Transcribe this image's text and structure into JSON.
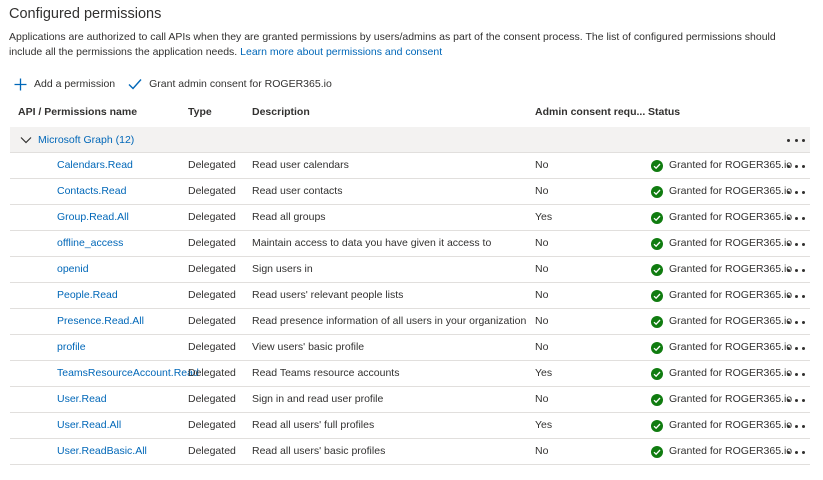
{
  "page": {
    "title": "Configured permissions",
    "description": "Applications are authorized to call APIs when they are granted permissions by users/admins as part of the consent process. The list of configured permissions should include all the permissions the application needs.",
    "learn_more_link": "Learn more about permissions and consent"
  },
  "toolbar": {
    "add_permission": "Add a permission",
    "grant_consent": "Grant admin consent for ROGER365.io"
  },
  "table": {
    "columns": [
      "API / Permissions name",
      "Type",
      "Description",
      "Admin consent requ...",
      "Status"
    ],
    "group": {
      "label": "Microsoft Graph (12)"
    },
    "rows": [
      {
        "name": "Calendars.Read",
        "type": "Delegated",
        "description": "Read user calendars",
        "admin": "No",
        "status": "Granted for ROGER365.io"
      },
      {
        "name": "Contacts.Read",
        "type": "Delegated",
        "description": "Read user contacts",
        "admin": "No",
        "status": "Granted for ROGER365.io"
      },
      {
        "name": "Group.Read.All",
        "type": "Delegated",
        "description": "Read all groups",
        "admin": "Yes",
        "status": "Granted for ROGER365.io"
      },
      {
        "name": "offline_access",
        "type": "Delegated",
        "description": "Maintain access to data you have given it access to",
        "admin": "No",
        "status": "Granted for ROGER365.io"
      },
      {
        "name": "openid",
        "type": "Delegated",
        "description": "Sign users in",
        "admin": "No",
        "status": "Granted for ROGER365.io"
      },
      {
        "name": "People.Read",
        "type": "Delegated",
        "description": "Read users' relevant people lists",
        "admin": "No",
        "status": "Granted for ROGER365.io"
      },
      {
        "name": "Presence.Read.All",
        "type": "Delegated",
        "description": "Read presence information of all users in your organization",
        "admin": "No",
        "status": "Granted for ROGER365.io"
      },
      {
        "name": "profile",
        "type": "Delegated",
        "description": "View users' basic profile",
        "admin": "No",
        "status": "Granted for ROGER365.io"
      },
      {
        "name": "TeamsResourceAccount.Read",
        "type": "Delegated",
        "description": "Read Teams resource accounts",
        "admin": "Yes",
        "status": "Granted for ROGER365.io"
      },
      {
        "name": "User.Read",
        "type": "Delegated",
        "description": "Sign in and read user profile",
        "admin": "No",
        "status": "Granted for ROGER365.io"
      },
      {
        "name": "User.Read.All",
        "type": "Delegated",
        "description": "Read all users' full profiles",
        "admin": "Yes",
        "status": "Granted for ROGER365.io"
      },
      {
        "name": "User.ReadBasic.All",
        "type": "Delegated",
        "description": "Read all users' basic profiles",
        "admin": "No",
        "status": "Granted for ROGER365.io"
      }
    ]
  },
  "colors": {
    "link": "#0067b8",
    "success": "#107c10",
    "text": "#323130",
    "border": "#e1dfdd",
    "group_bg": "#f3f2f1"
  },
  "icons": {
    "add": "plus-icon",
    "consent": "checkmark-icon",
    "expand": "chevron-down-icon",
    "status": "check-circle-icon",
    "row_menu": "more-icon"
  }
}
